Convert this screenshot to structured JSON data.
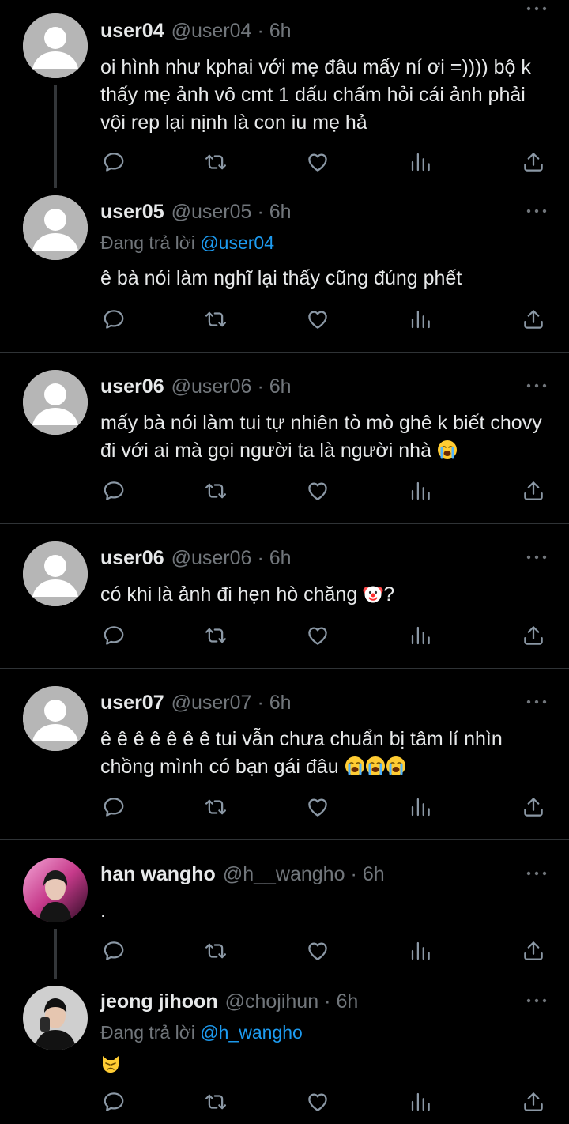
{
  "colors": {
    "background": "#000000",
    "text": "#e7e9ea",
    "secondary": "#71767b",
    "mention": "#1d9bf0",
    "divider": "#2f3336",
    "default_avatar": "#b6b6b6"
  },
  "dot": "·",
  "tweets": [
    {
      "name": "user04",
      "handle": "@user04",
      "time": "6h",
      "text": "oi hình như kphai với mẹ đâu mấy ní ơi =)))) bộ k thấy mẹ ảnh vô cmt 1 dấu chấm hỏi cái ảnh phải vội rep lại nịnh là con iu mẹ hả",
      "avatar": "default-avatar-icon"
    },
    {
      "name": "user05",
      "handle": "@user05",
      "time": "6h",
      "reply_prefix": "Đang trả lời",
      "reply_mention": "@user04",
      "text": "ê bà nói làm nghĩ lại thấy cũng đúng phết",
      "avatar": "default-avatar-icon"
    },
    {
      "name": "user06",
      "handle": "@user06",
      "time": "6h",
      "text": "mấy bà nói làm tui tự nhiên tò mò ghê k biết chovy đi với ai mà gọi người ta là người nhà",
      "emoji": [
        "loudly-crying-face-emoji"
      ],
      "avatar": "default-avatar-icon"
    },
    {
      "name": "user06",
      "handle": "@user06",
      "time": "6h",
      "text": "có khi là ảnh đi hẹn hò chăng",
      "emoji": [
        "clown-face-emoji"
      ],
      "text_after": "?",
      "avatar": "default-avatar-icon"
    },
    {
      "name": "user07",
      "handle": "@user07",
      "time": "6h",
      "text": "ê ê ê ê ê ê ê tui vẫn chưa chuẩn bị tâm lí nhìn chồng mình có bạn gái đâu",
      "emoji": [
        "loudly-crying-face-emoji",
        "loudly-crying-face-emoji",
        "loudly-crying-face-emoji"
      ],
      "avatar": "default-avatar-icon"
    },
    {
      "name": "han wangho",
      "handle": "@h__wangho",
      "time": "6h",
      "text": ".",
      "avatar": "profile-photo-han-wangho"
    },
    {
      "name": "jeong jihoon",
      "handle": "@chojihun",
      "time": "6h",
      "reply_prefix": "Đang trả lời",
      "reply_mention": "@h_wangho",
      "text": "",
      "emoji": [
        "pouting-cat-emoji"
      ],
      "avatar": "profile-photo-jeong-jihoon"
    }
  ],
  "action_icons": [
    "reply-icon",
    "retweet-icon",
    "like-icon",
    "views-icon",
    "share-icon"
  ],
  "more_icon": "more-options-icon"
}
